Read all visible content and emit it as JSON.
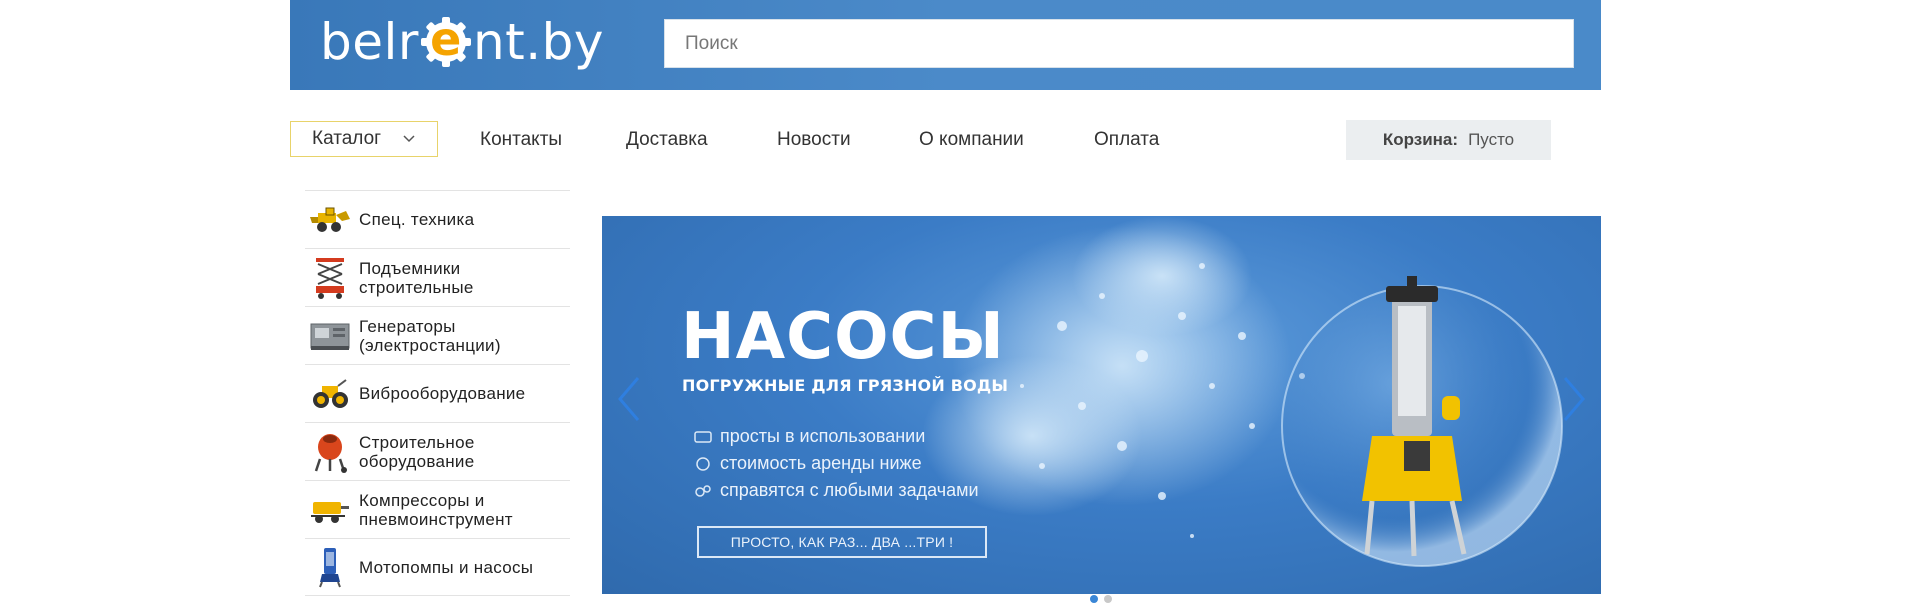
{
  "header": {
    "logo_left": "belr",
    "logo_mid": "e",
    "logo_right": "nt.by",
    "search_placeholder": "Поиск"
  },
  "nav": {
    "catalog_label": "Каталог",
    "links": [
      "Контакты",
      "Доставка",
      "Новости",
      "О компании",
      "Оплата"
    ]
  },
  "cart": {
    "label": "Корзина:",
    "value": "Пусто"
  },
  "sidebar": {
    "items": [
      {
        "label": "Спец. техника",
        "icon": "loader-icon"
      },
      {
        "label": "Подъемники строительные",
        "icon": "scissor-lift-icon"
      },
      {
        "label": "Генераторы (электростанции)",
        "icon": "generator-icon"
      },
      {
        "label": "Виброоборудование",
        "icon": "vibro-roller-icon"
      },
      {
        "label": "Строительное оборудование",
        "icon": "concrete-mixer-icon"
      },
      {
        "label": "Компрессоры и пневмоинструмент",
        "icon": "compressor-icon"
      },
      {
        "label": "Мотопомпы и насосы",
        "icon": "pump-icon"
      }
    ]
  },
  "banner": {
    "title": "НАСОСЫ",
    "subtitle": "ПОГРУЖНЫЕ ДЛЯ ГРЯЗНОЙ ВОДЫ",
    "features": [
      "просты в использовании",
      "стоимость аренды ниже",
      "справятся с любыми задачами"
    ],
    "button": "ПРОСТО, КАК РАЗ... ДВА ...ТРИ !"
  },
  "slider": {
    "count": 2,
    "active": 0
  },
  "colors": {
    "header": "#4a8ac9",
    "accent": "#f5a300",
    "catalog_border": "#e8d36a",
    "dot_active": "#3a86d6"
  }
}
